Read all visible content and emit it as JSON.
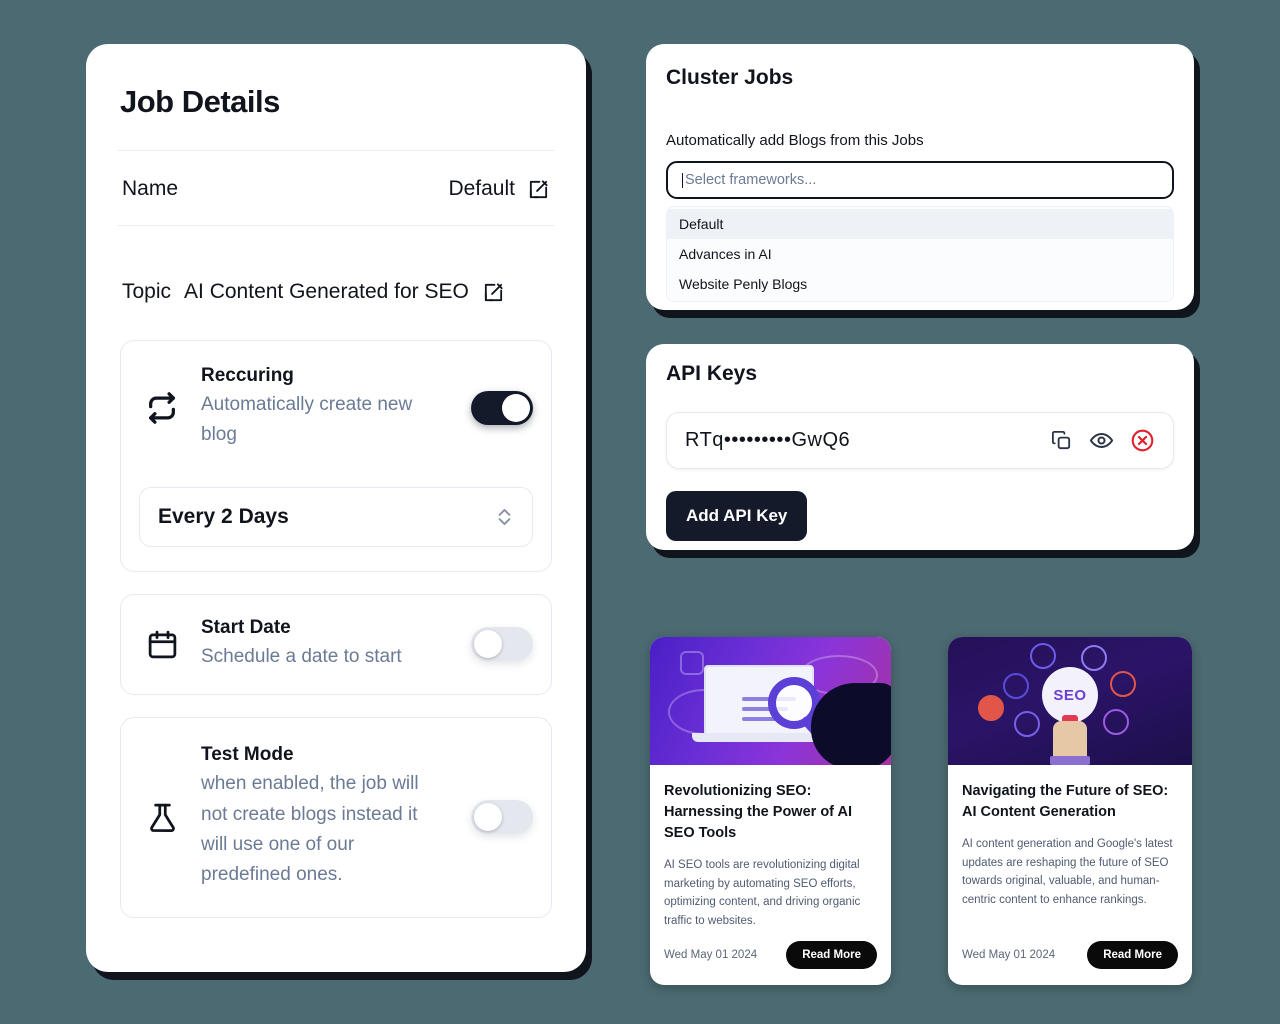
{
  "job_details": {
    "title": "Job Details",
    "name_label": "Name",
    "name_value": "Default",
    "topic_label": "Topic",
    "topic_value": "AI Content Generated for SEO",
    "recurring": {
      "icon": "repeat-icon",
      "title": "Reccuring",
      "description": "Automatically create new blog",
      "toggle_state": "on",
      "frequency_value": "Every 2 Days"
    },
    "start_date": {
      "icon": "calendar-icon",
      "title": "Start Date",
      "description": "Schedule a date to start",
      "toggle_state": "off"
    },
    "test_mode": {
      "icon": "flask-icon",
      "title": "Test Mode",
      "description": "when enabled, the job will not create blogs instead it will use one of our predefined ones.",
      "toggle_state": "off"
    },
    "edit_icon": "edit-pencil-icon",
    "stepper_icon": "chevron-up-down-icon"
  },
  "cluster_jobs": {
    "title": "Cluster Jobs",
    "subtitle": "Automatically add Blogs from this Jobs",
    "input_placeholder": "Select frameworks...",
    "options": [
      {
        "label": "Default",
        "selected": true
      },
      {
        "label": "Advances in AI",
        "selected": false
      },
      {
        "label": "Website Penly Blogs",
        "selected": false
      }
    ]
  },
  "api_keys": {
    "title": "API Keys",
    "key_value": "RTq•••••••••GwQ6",
    "copy_icon": "copy-icon",
    "reveal_icon": "eye-icon",
    "delete_icon": "x-circle-icon",
    "delete_icon_color": "#e0202a",
    "add_button_label": "Add API Key"
  },
  "blog_cards": [
    {
      "image_alt": "seo-laptop-magnifier-illustration",
      "title": "Revolutionizing SEO: Harnessing the Power of AI SEO Tools",
      "description": "AI SEO tools are revolutionizing digital marketing by automating SEO efforts, optimizing content, and driving organic traffic to websites.",
      "date": "Wed May 01 2024",
      "button_label": "Read More"
    },
    {
      "image_alt": "seo-network-hand-illustration",
      "title": "Navigating the Future of SEO: AI Content Generation",
      "description": "AI content generation and Google's latest updates are reshaping the future of SEO towards original, valuable, and human-centric content to enhance rankings.",
      "date": "Wed May 01 2024",
      "button_label": "Read More"
    }
  ],
  "theme": {
    "background": "#4c6a71",
    "accent_dark": "#141a2a",
    "muted_text": "#6b7a95"
  }
}
